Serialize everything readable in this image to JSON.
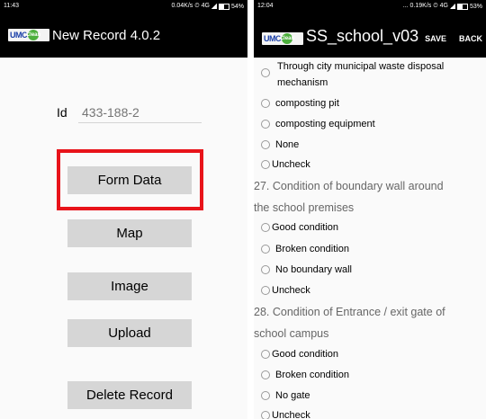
{
  "left": {
    "status": {
      "time": "11:43",
      "info": "0.04K/s ⏲ 4G",
      "battery": "54%"
    },
    "header": {
      "logo": "UMC",
      "logo_badge": "Clean",
      "title": "New Record 4.0.2"
    },
    "id_field": {
      "label": "Id",
      "placeholder": "433-188-2"
    },
    "buttons": [
      "Form Data",
      "Map",
      "Image",
      "Upload",
      "Delete Record"
    ],
    "highlight_color": "#e8131a"
  },
  "right": {
    "status": {
      "time": "12:04",
      "info": "... 0.19K/s ⏲ 4G",
      "battery": "53%"
    },
    "header": {
      "logo": "UMC",
      "logo_badge": "Clean",
      "title": "SS_school_v03",
      "save_label": "SAVE",
      "back_label": "BACK"
    },
    "options_top": [
      "Through city municipal waste disposal",
      "mechanism",
      "composting pit",
      "composting equipment",
      "None",
      "Uncheck"
    ],
    "q27": {
      "line1": "27. Condition of boundary wall around",
      "line2": "the school premises"
    },
    "q27_options": [
      "Good condition",
      "Broken condition",
      "No boundary wall",
      "Uncheck"
    ],
    "q28": {
      "line1": "28. Condition of Entrance / exit gate of",
      "line2": "school campus"
    },
    "q28_options": [
      "Good condition",
      "Broken condition",
      "No gate",
      "Uncheck"
    ]
  }
}
